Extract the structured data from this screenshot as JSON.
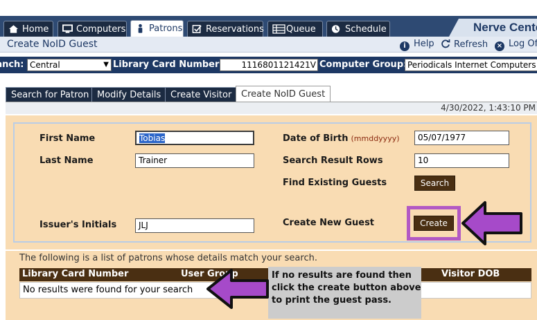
{
  "top_tabs": [
    {
      "label": "Home",
      "icon": "home-icon"
    },
    {
      "label": "Computers",
      "icon": "monitor-icon"
    },
    {
      "label": "Patrons",
      "icon": "person-icon"
    },
    {
      "label": "Reservations",
      "icon": "checkbox-icon"
    },
    {
      "label": "Queue",
      "icon": "list-icon"
    },
    {
      "label": "Schedule",
      "icon": "clock-icon"
    }
  ],
  "brand": "Nerve Center",
  "subheader": {
    "title": "Create NoID Guest",
    "help": "Help",
    "refresh": "Refresh",
    "logoff": "Log Off"
  },
  "filters": {
    "branch_label": "Branch:",
    "branch_value": "Central",
    "card_label": "Library Card Number:",
    "card_value": "1116801121421V",
    "group_label": "Computer Group:",
    "group_value": "Periodicals Internet Computers"
  },
  "sub_tabs": [
    "Search for Patron",
    "Modify Details",
    "Create Visitor",
    "Create NoID Guest"
  ],
  "datetime": "4/30/2022, 1:43:10 PM",
  "form": {
    "first_name_label": "First Name",
    "first_name_value": "Tobias",
    "last_name_label": "Last Name",
    "last_name_value": "Trainer",
    "issuer_label": "Issuer's Initials",
    "issuer_value": "JLJ",
    "dob_label": "Date of Birth",
    "dob_hint": "(mmddyyyy)",
    "dob_value": "05/07/1977",
    "rows_label": "Search Result Rows",
    "rows_value": "10",
    "find_label": "Find Existing Guests",
    "search_button": "Search",
    "create_label": "Create New Guest",
    "create_button": "Create"
  },
  "results": {
    "caption": "The following is a list of patrons whose details match your search.",
    "columns": [
      "Library Card Number",
      "User Group",
      "Visitor DOB"
    ],
    "empty_message": "No results were found for your search"
  },
  "callout": {
    "lines": [
      "If no results are found then",
      "click the create button above",
      "to print the guest pass."
    ]
  },
  "colors": {
    "nav_dark": "#1d3864",
    "form_bg": "#f9dcb3",
    "button_brown": "#4a2f12",
    "annotation_purple": "#a64ac9"
  }
}
